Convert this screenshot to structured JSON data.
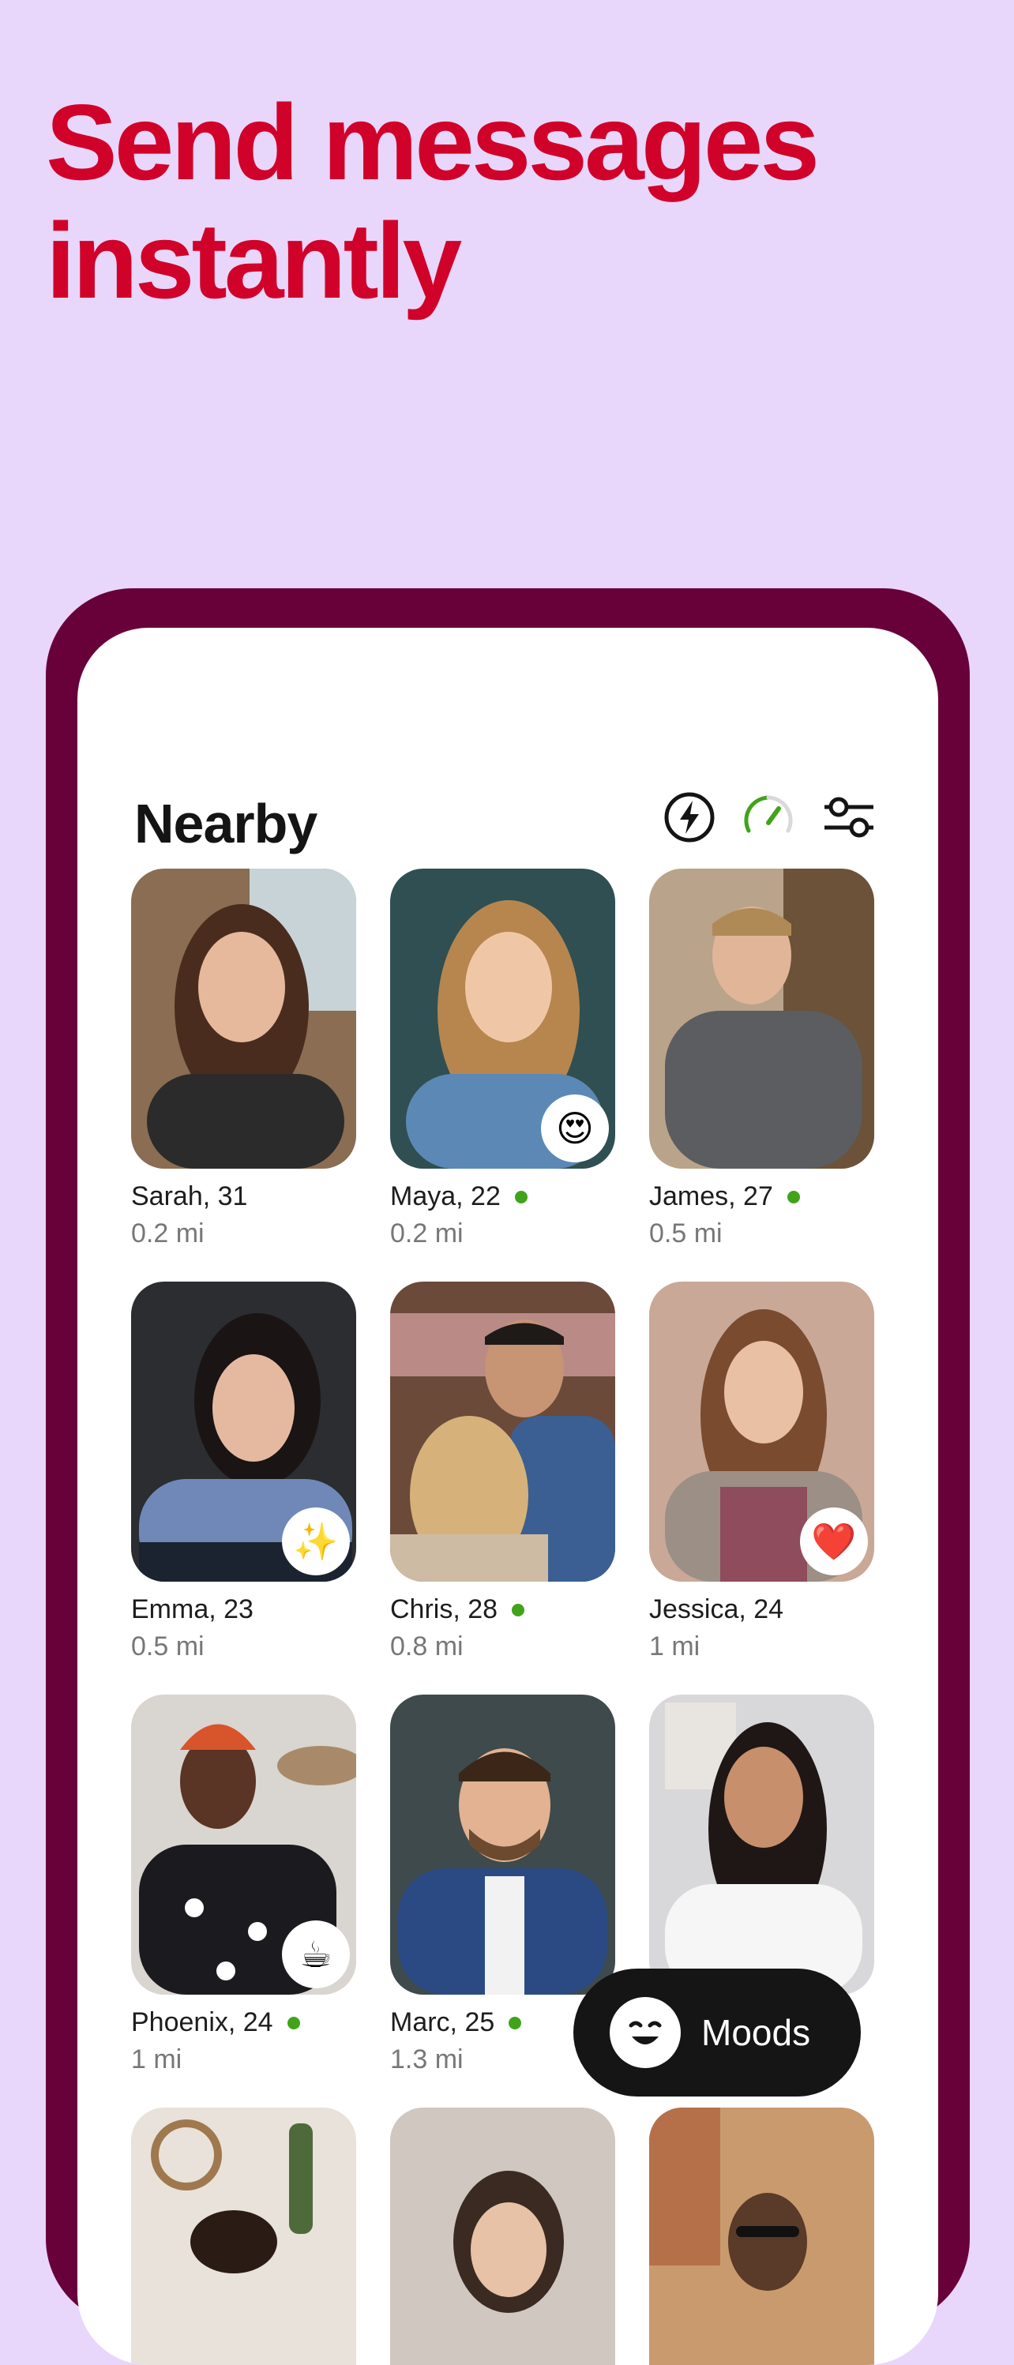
{
  "headline": {
    "line1": "Send messages",
    "line2": "instantly"
  },
  "colors": {
    "background": "#e9d6fb",
    "headline": "#d0022a",
    "phone_frame": "#68013a",
    "online": "#41a31a"
  },
  "screen": {
    "title": "Nearby",
    "header_icons": [
      "boost-icon",
      "speedometer-icon",
      "filter-sliders-icon"
    ]
  },
  "profiles": [
    {
      "name": "Sarah, 31",
      "distance": "0.2 mi",
      "online": false,
      "badge": ""
    },
    {
      "name": "Maya, 22",
      "distance": "0.2 mi",
      "online": true,
      "badge": "😍"
    },
    {
      "name": "James, 27",
      "distance": "0.5 mi",
      "online": true,
      "badge": ""
    },
    {
      "name": "Emma, 23",
      "distance": "0.5 mi",
      "online": false,
      "badge": "✨"
    },
    {
      "name": "Chris, 28",
      "distance": "0.8 mi",
      "online": true,
      "badge": ""
    },
    {
      "name": "Jessica, 24",
      "distance": "1 mi",
      "online": false,
      "badge": "❤️"
    },
    {
      "name": "Phoenix, 24",
      "distance": "1 mi",
      "online": true,
      "badge": "☕"
    },
    {
      "name": "Marc, 25",
      "distance": "1.3 mi",
      "online": true,
      "badge": ""
    },
    {
      "name": "",
      "distance": "",
      "online": false,
      "badge": ""
    }
  ],
  "moods_button": {
    "label": "Moods",
    "icon": "smiley-face-icon"
  }
}
